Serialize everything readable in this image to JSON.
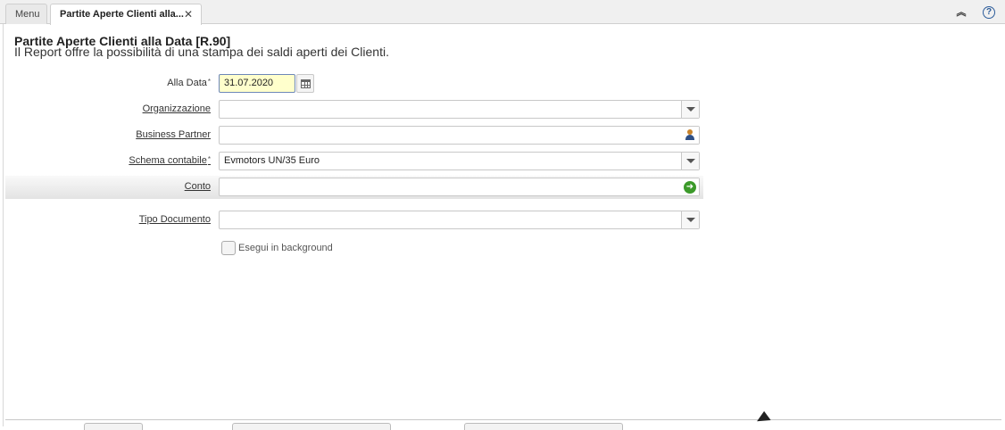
{
  "tabs": [
    {
      "label": "Menu"
    },
    {
      "label": "Partite Aperte Clienti alla..."
    }
  ],
  "header": {
    "title": "Partite Aperte Clienti alla Data [R.90]",
    "subtitle": "Il Report offre la possibilità di una stampa dei saldi aperti dei Clienti."
  },
  "form": {
    "alla_data": {
      "label": "Alla Data",
      "value": "31.07.2020",
      "required": "*"
    },
    "organizzazione": {
      "label": "Organizzazione",
      "value": ""
    },
    "business_partner": {
      "label": "Business Partner",
      "value": ""
    },
    "schema_contabile": {
      "label": "Schema contabile",
      "value": "Evmotors UN/35 Euro",
      "required": "*"
    },
    "conto": {
      "label": "Conto",
      "value": ""
    },
    "tipo_documento": {
      "label": "Tipo Documento",
      "value": ""
    },
    "background": {
      "label": "Esegui in background",
      "checked": false
    }
  },
  "icons": {
    "close": "close-icon",
    "collapse": "collapse-up-icon",
    "help": "help-icon",
    "calendar": "calendar-icon",
    "dropdown": "chevron-down-icon",
    "person": "person-icon",
    "go": "green-arrow-icon"
  }
}
